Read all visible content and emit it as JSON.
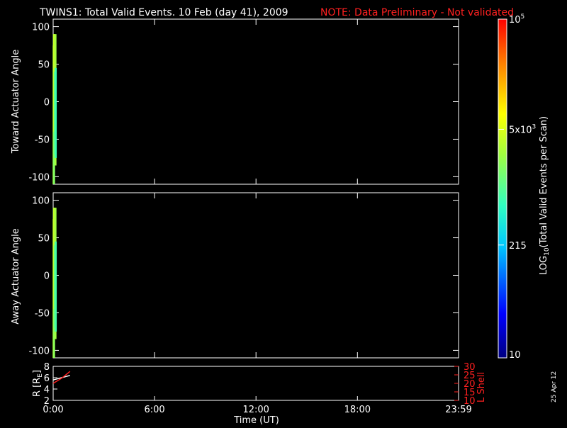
{
  "header": {
    "title": "TWINS1: Total Valid Events. 10 Feb (day  41), 2009",
    "note": "NOTE: Data Preliminary - Not validated",
    "note_color": "#ff2020"
  },
  "stamp": "25 Apr 12",
  "chart_data": [
    {
      "type": "heatmap",
      "title": "",
      "ylabel": "Toward Actuator Angle",
      "xlim": [
        "0:00",
        "23:59"
      ],
      "ylim": [
        -110,
        110
      ],
      "yticks": [
        -100,
        -50,
        0,
        50,
        100
      ],
      "xticks": [
        "0:00",
        "6:00",
        "12:00",
        "18:00",
        "23:59"
      ],
      "grid": false,
      "columns": [
        {
          "t": "0:02",
          "y0": -110,
          "y1": 75,
          "events": 3500
        },
        {
          "t": "0:03",
          "y0": -110,
          "y1": 90,
          "events": 1800
        },
        {
          "t": "0:04",
          "y0": -40,
          "y1": 90,
          "events": 4200
        },
        {
          "t": "0:06",
          "y0": -70,
          "y1": 40,
          "events": 900
        },
        {
          "t": "0:08",
          "y0": -85,
          "y1": 90,
          "events": 2600
        },
        {
          "t": "0:09",
          "y0": -75,
          "y1": 45,
          "events": 700
        }
      ]
    },
    {
      "type": "heatmap",
      "title": "",
      "ylabel": "Away Actuator Angle",
      "xlim": [
        "0:00",
        "23:59"
      ],
      "ylim": [
        -110,
        110
      ],
      "yticks": [
        -100,
        -50,
        0,
        50,
        100
      ],
      "xticks": [
        "0:00",
        "6:00",
        "12:00",
        "18:00",
        "23:59"
      ],
      "grid": false,
      "columns": [
        {
          "t": "0:02",
          "y0": -110,
          "y1": 75,
          "events": 4300
        },
        {
          "t": "0:03",
          "y0": -110,
          "y1": 90,
          "events": 2000
        },
        {
          "t": "0:04",
          "y0": -45,
          "y1": 90,
          "events": 4000
        },
        {
          "t": "0:06",
          "y0": -70,
          "y1": 40,
          "events": 1000
        },
        {
          "t": "0:08",
          "y0": -85,
          "y1": 90,
          "events": 2500
        },
        {
          "t": "0:09",
          "y0": -75,
          "y1": 45,
          "events": 800
        }
      ]
    },
    {
      "type": "line",
      "title": "",
      "xlabel": "Time (UT)",
      "ylabel": "R [R",
      "ylabel_sub": "E",
      "ylabel_close": "]",
      "y2label": "L Shell",
      "ylim": [
        2,
        8
      ],
      "yticks": [
        2,
        4,
        6,
        8
      ],
      "y2lim": [
        10,
        30
      ],
      "y2ticks": [
        10,
        15,
        20,
        25,
        30
      ],
      "y2color": "#ff2020",
      "xticks": [
        "0:00",
        "6:00",
        "12:00",
        "18:00",
        "23:59"
      ],
      "series": [
        {
          "color": "#ffffff",
          "x": [
            "0:00",
            "0:30",
            "1:00"
          ],
          "y": [
            5.6,
            6.0,
            6.4
          ]
        },
        {
          "color": "#ff2020",
          "x": [
            "0:00",
            "0:30",
            "1:00"
          ],
          "y": [
            20,
            23,
            27
          ]
        }
      ]
    }
  ],
  "colorbar": {
    "label": "LOG",
    "label_sub": "10",
    "label_rest": "(Total Valid  Events per Scan)",
    "ticks": [
      {
        "text": "10",
        "value": 10
      },
      {
        "text": "215",
        "value": 215
      },
      {
        "text": "5x10",
        "sup": "3",
        "value": 5000
      },
      {
        "text": "10",
        "sup": "5",
        "value": 100000
      }
    ],
    "range": [
      10,
      100000
    ],
    "scale": "log"
  }
}
